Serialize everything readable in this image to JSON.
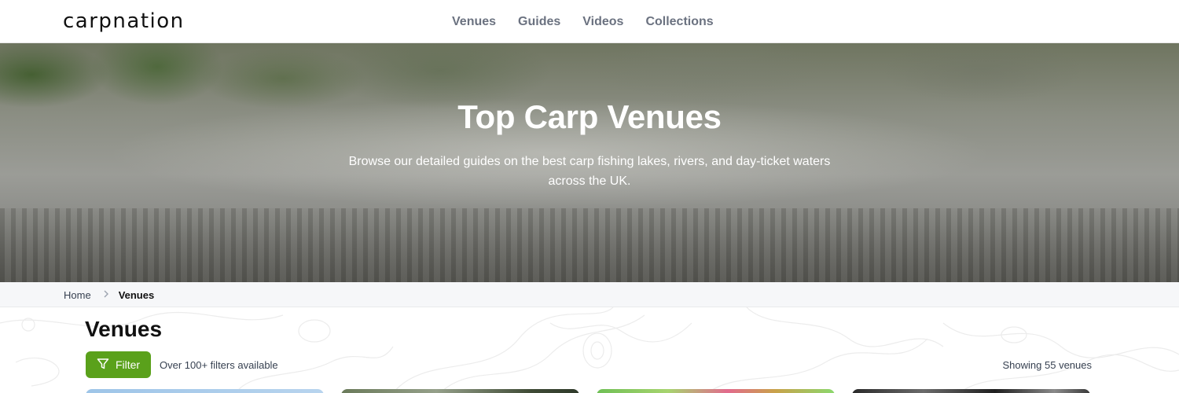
{
  "brand": {
    "logo_text": "carpnation"
  },
  "nav": {
    "items": [
      "Venues",
      "Guides",
      "Videos",
      "Collections"
    ]
  },
  "hero": {
    "title": "Top Carp Venues",
    "subtitle": "Browse our detailed guides on the best carp fishing lakes, rivers, and day-ticket waters across the UK."
  },
  "breadcrumb": {
    "home": "Home",
    "current": "Venues"
  },
  "main": {
    "title": "Venues",
    "filter_label": "Filter",
    "filter_note": "Over 100+ filters available",
    "count_note": "Showing 55 venues"
  },
  "colors": {
    "accent": "#5aa11b",
    "nav_text": "#6b7280"
  },
  "icons": {
    "filter": "filter-icon",
    "chevron": "chevron-right-icon"
  }
}
